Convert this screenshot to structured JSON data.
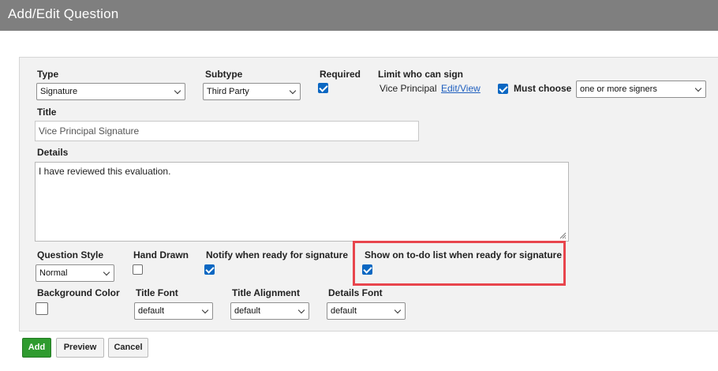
{
  "window": {
    "title": "Add/Edit Question"
  },
  "form": {
    "type": {
      "label": "Type",
      "value": "Signature"
    },
    "subtype": {
      "label": "Subtype",
      "value": "Third Party"
    },
    "required": {
      "label": "Required",
      "checked": true
    },
    "limit": {
      "label": "Limit who can sign",
      "signer": "Vice Principal",
      "link": "Edit/View"
    },
    "must_choose": {
      "label": "Must choose",
      "checked": true,
      "value": "one or more signers"
    },
    "title": {
      "label": "Title",
      "value": "Vice Principal Signature"
    },
    "details": {
      "label": "Details",
      "value": "I have reviewed this evaluation."
    },
    "question_style": {
      "label": "Question Style",
      "value": "Normal"
    },
    "hand_drawn": {
      "label": "Hand Drawn",
      "checked": false
    },
    "notify": {
      "label": "Notify when ready for signature",
      "checked": true
    },
    "show_todo": {
      "label": "Show on to-do list when ready for signature",
      "checked": true
    },
    "background_color": {
      "label": "Background Color"
    },
    "title_font": {
      "label": "Title Font",
      "value": "default"
    },
    "title_alignment": {
      "label": "Title Alignment",
      "value": "default"
    },
    "details_font": {
      "label": "Details Font",
      "value": "default"
    }
  },
  "buttons": {
    "add": "Add",
    "preview": "Preview",
    "cancel": "Cancel"
  },
  "colors": {
    "checkbox": "#0b67c2",
    "add_button": "#2f9b2f",
    "highlight": "#e8454d",
    "titlebar": "#7f7f7f"
  }
}
